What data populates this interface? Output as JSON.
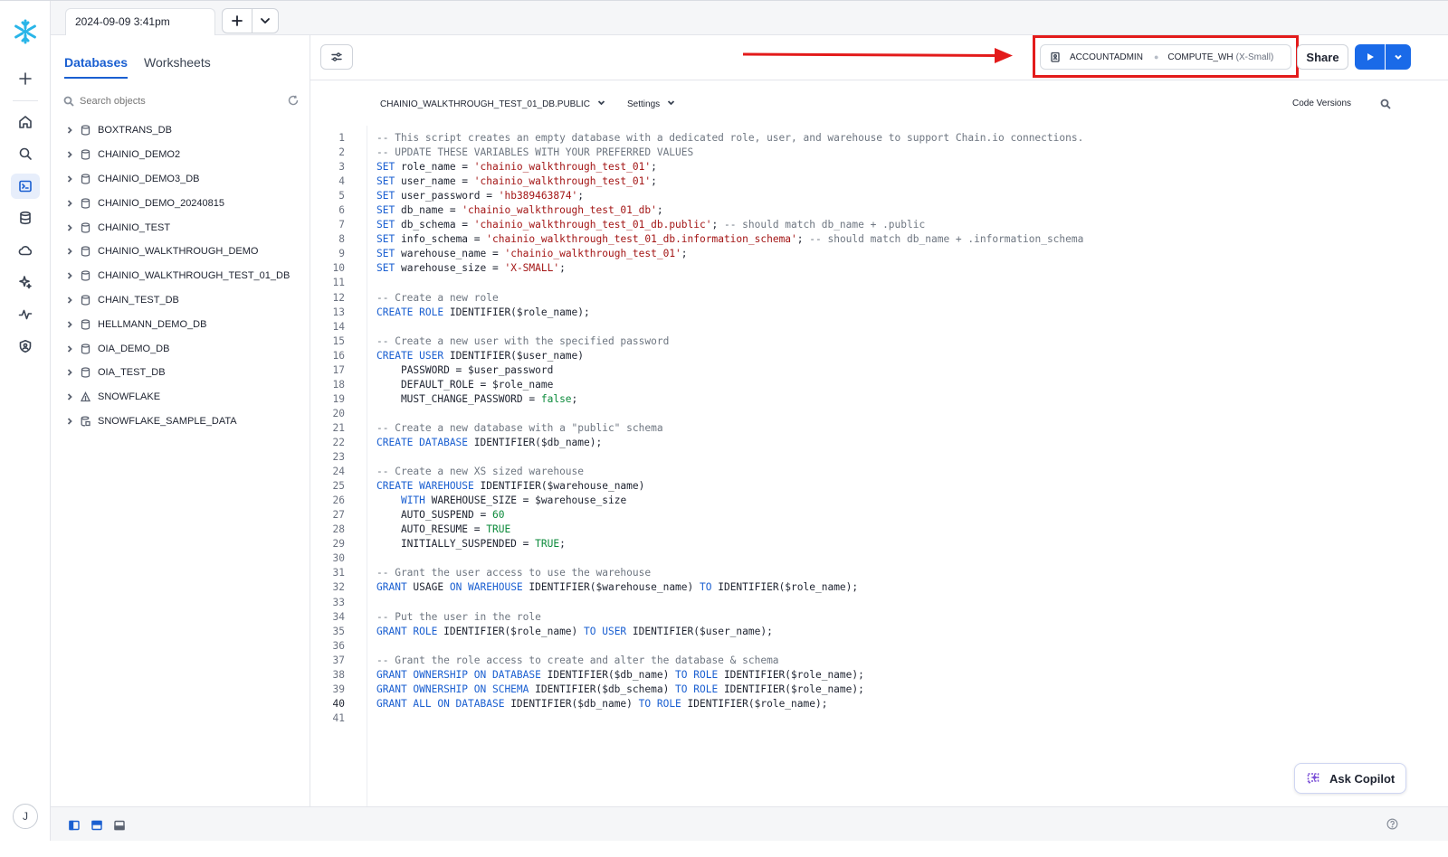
{
  "tab": {
    "title": "2024-09-09 3:41pm"
  },
  "browser": {
    "tabs": [
      "Databases",
      "Worksheets"
    ],
    "search_placeholder": "Search objects",
    "databases": [
      {
        "name": "BOXTRANS_DB",
        "icon": "database-icon"
      },
      {
        "name": "CHAINIO_DEMO2",
        "icon": "database-icon"
      },
      {
        "name": "CHAINIO_DEMO3_DB",
        "icon": "database-icon"
      },
      {
        "name": "CHAINIO_DEMO_20240815",
        "icon": "database-icon"
      },
      {
        "name": "CHAINIO_TEST",
        "icon": "database-icon"
      },
      {
        "name": "CHAINIO_WALKTHROUGH_DEMO",
        "icon": "database-icon"
      },
      {
        "name": "CHAINIO_WALKTHROUGH_TEST_01_DB",
        "icon": "database-icon"
      },
      {
        "name": "CHAIN_TEST_DB",
        "icon": "database-icon"
      },
      {
        "name": "HELLMANN_DEMO_DB",
        "icon": "database-icon"
      },
      {
        "name": "OIA_DEMO_DB",
        "icon": "database-icon"
      },
      {
        "name": "OIA_TEST_DB",
        "icon": "database-icon"
      },
      {
        "name": "SNOWFLAKE",
        "icon": "shared-database-icon"
      },
      {
        "name": "SNOWFLAKE_SAMPLE_DATA",
        "icon": "sample-database-icon"
      }
    ]
  },
  "toolbar": {
    "role": "ACCOUNTADMIN",
    "warehouse": "COMPUTE_WH",
    "warehouse_size": "(X-Small)",
    "share_label": "Share"
  },
  "editor": {
    "context": "CHAINIO_WALKTHROUGH_TEST_01_DB.PUBLIC",
    "settings_label": "Settings",
    "code_versions_label": "Code Versions",
    "current_line": 40,
    "lines": [
      [
        [
          "c",
          "-- This script creates an empty database with a dedicated role, user, and warehouse to support Chain.io connections."
        ]
      ],
      [
        [
          "c",
          "-- UPDATE THESE VARIABLES WITH YOUR PREFERRED VALUES"
        ]
      ],
      [
        [
          "k",
          "SET"
        ],
        [
          "t",
          " role_name = "
        ],
        [
          "s",
          "'chainio_walkthrough_test_01'"
        ],
        [
          "t",
          ";"
        ]
      ],
      [
        [
          "k",
          "SET"
        ],
        [
          "t",
          " user_name = "
        ],
        [
          "s",
          "'chainio_walkthrough_test_01'"
        ],
        [
          "t",
          ";"
        ]
      ],
      [
        [
          "k",
          "SET"
        ],
        [
          "t",
          " user_password = "
        ],
        [
          "s",
          "'hb389463874'"
        ],
        [
          "t",
          ";"
        ]
      ],
      [
        [
          "k",
          "SET"
        ],
        [
          "t",
          " db_name = "
        ],
        [
          "s",
          "'chainio_walkthrough_test_01_db'"
        ],
        [
          "t",
          ";"
        ]
      ],
      [
        [
          "k",
          "SET"
        ],
        [
          "t",
          " db_schema = "
        ],
        [
          "s",
          "'chainio_walkthrough_test_01_db.public'"
        ],
        [
          "t",
          "; "
        ],
        [
          "c",
          "-- should match db_name + .public"
        ]
      ],
      [
        [
          "k",
          "SET"
        ],
        [
          "t",
          " info_schema = "
        ],
        [
          "s",
          "'chainio_walkthrough_test_01_db.information_schema'"
        ],
        [
          "t",
          "; "
        ],
        [
          "c",
          "-- should match db_name + .information_schema"
        ]
      ],
      [
        [
          "k",
          "SET"
        ],
        [
          "t",
          " warehouse_name = "
        ],
        [
          "s",
          "'chainio_walkthrough_test_01'"
        ],
        [
          "t",
          ";"
        ]
      ],
      [
        [
          "k",
          "SET"
        ],
        [
          "t",
          " warehouse_size = "
        ],
        [
          "s",
          "'X-SMALL'"
        ],
        [
          "t",
          ";"
        ]
      ],
      [],
      [
        [
          "c",
          "-- Create a new role"
        ]
      ],
      [
        [
          "k",
          "CREATE ROLE"
        ],
        [
          "t",
          " IDENTIFIER($role_name);"
        ]
      ],
      [],
      [
        [
          "c",
          "-- Create a new user with the specified password"
        ]
      ],
      [
        [
          "k",
          "CREATE USER"
        ],
        [
          "t",
          " IDENTIFIER($user_name)"
        ]
      ],
      [
        [
          "t",
          "    PASSWORD = $user_password"
        ]
      ],
      [
        [
          "t",
          "    DEFAULT_ROLE = $role_name"
        ]
      ],
      [
        [
          "t",
          "    MUST_CHANGE_PASSWORD = "
        ],
        [
          "n",
          "false"
        ],
        [
          "t",
          ";"
        ]
      ],
      [],
      [
        [
          "c",
          "-- Create a new database with a \"public\" schema"
        ]
      ],
      [
        [
          "k",
          "CREATE DATABASE"
        ],
        [
          "t",
          " IDENTIFIER($db_name);"
        ]
      ],
      [],
      [
        [
          "c",
          "-- Create a new XS sized warehouse"
        ]
      ],
      [
        [
          "k",
          "CREATE WAREHOUSE"
        ],
        [
          "t",
          " IDENTIFIER($warehouse_name)"
        ]
      ],
      [
        [
          "t",
          "    "
        ],
        [
          "k",
          "WITH"
        ],
        [
          "t",
          " WAREHOUSE_SIZE = $warehouse_size"
        ]
      ],
      [
        [
          "t",
          "    AUTO_SUSPEND = "
        ],
        [
          "n",
          "60"
        ]
      ],
      [
        [
          "t",
          "    AUTO_RESUME = "
        ],
        [
          "n",
          "TRUE"
        ]
      ],
      [
        [
          "t",
          "    INITIALLY_SUSPENDED = "
        ],
        [
          "n",
          "TRUE"
        ],
        [
          "t",
          ";"
        ]
      ],
      [],
      [
        [
          "c",
          "-- Grant the user access to use the warehouse"
        ]
      ],
      [
        [
          "k",
          "GRANT"
        ],
        [
          "t",
          " USAGE "
        ],
        [
          "k",
          "ON WAREHOUSE"
        ],
        [
          "t",
          " IDENTIFIER($warehouse_name) "
        ],
        [
          "k",
          "TO"
        ],
        [
          "t",
          " IDENTIFIER($role_name);"
        ]
      ],
      [],
      [
        [
          "c",
          "-- Put the user in the role"
        ]
      ],
      [
        [
          "k",
          "GRANT ROLE"
        ],
        [
          "t",
          " IDENTIFIER($role_name) "
        ],
        [
          "k",
          "TO USER"
        ],
        [
          "t",
          " IDENTIFIER($user_name);"
        ]
      ],
      [],
      [
        [
          "c",
          "-- Grant the role access to create and alter the database & schema"
        ]
      ],
      [
        [
          "k",
          "GRANT OWNERSHIP ON DATABASE"
        ],
        [
          "t",
          " IDENTIFIER($db_name) "
        ],
        [
          "k",
          "TO ROLE"
        ],
        [
          "t",
          " IDENTIFIER($role_name);"
        ]
      ],
      [
        [
          "k",
          "GRANT OWNERSHIP ON SCHEMA"
        ],
        [
          "t",
          " IDENTIFIER($db_schema) "
        ],
        [
          "k",
          "TO ROLE"
        ],
        [
          "t",
          " IDENTIFIER($role_name);"
        ]
      ],
      [
        [
          "k",
          "GRANT ALL ON DATABASE"
        ],
        [
          "t",
          " IDENTIFIER($db_name) "
        ],
        [
          "k",
          "TO ROLE"
        ],
        [
          "t",
          " IDENTIFIER($role_name);"
        ]
      ],
      []
    ]
  },
  "copilot": {
    "label": "Ask Copilot"
  },
  "user": {
    "initial": "J"
  },
  "colors": {
    "accent": "#1a6ae8",
    "highlight_box": "#e31b1b",
    "arrow": "#e31b1b"
  }
}
